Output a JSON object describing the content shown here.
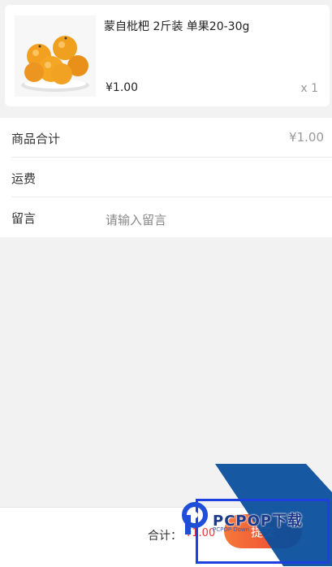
{
  "product": {
    "image": "loquat-fruit-photo",
    "title": "蒙自枇杷 2斤装 单果20-30g",
    "price": "¥1.00",
    "quantity": "x 1"
  },
  "summary": {
    "subtotal_label": "商品合计",
    "subtotal_value": "¥1.00",
    "shipping_label": "运费",
    "remark_label": "留言",
    "remark_placeholder": "请输入留言"
  },
  "footer": {
    "total_label": "合计：",
    "total_value": "¥1.00",
    "submit_label": "提交"
  },
  "watermark": {
    "logo": "pcpop-logo",
    "text": "PCPOP下载",
    "subtext": "PCPOP Down"
  },
  "colors": {
    "accent_start": "#f5793b",
    "accent_end": "#ef3f30",
    "price_red": "#e53935",
    "watermark_blue": "#0a4f9c"
  }
}
